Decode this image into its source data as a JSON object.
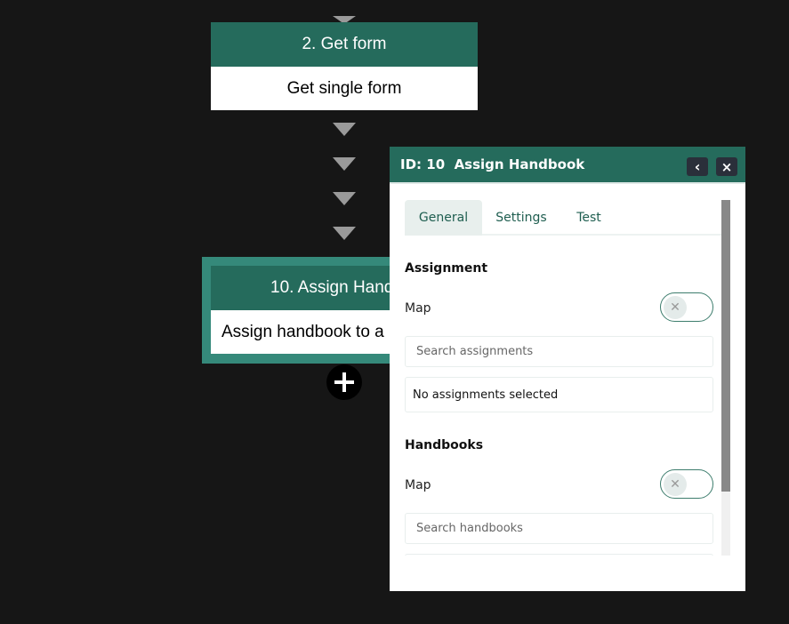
{
  "nodes": [
    {
      "header": "2. Get form",
      "body": "Get single form"
    },
    {
      "header": "10. Assign Hand",
      "body": "Assign handbook to a"
    }
  ],
  "panel": {
    "title": "ID: 10  Assign Handbook",
    "back_icon": "‹",
    "close_icon": "×",
    "tabs": [
      "General",
      "Settings",
      "Test"
    ],
    "active_tab": "General",
    "assignment": {
      "heading": "Assignment",
      "map_label": "Map",
      "map_enabled": false,
      "search_placeholder": "Search assignments",
      "empty_text": "No assignments selected"
    },
    "handbooks": {
      "heading": "Handbooks",
      "map_label": "Map",
      "map_enabled": false,
      "search_placeholder": "Search handbooks"
    }
  },
  "colors": {
    "header": "#256b5c",
    "selected_frame": "#35897a",
    "background": "#161616"
  }
}
